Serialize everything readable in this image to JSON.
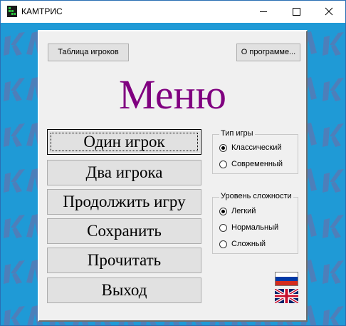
{
  "window": {
    "title": "КАМТРИС"
  },
  "toolbar": {
    "players_table": "Таблица игроков",
    "about": "О программе..."
  },
  "menu_title": "Меню",
  "main_buttons": {
    "one_player": "Один игрок",
    "two_players": "Два игрока",
    "continue_game": "Продолжить игру",
    "save": "Сохранить",
    "load": "Прочитать",
    "exit": "Выход"
  },
  "game_type": {
    "legend": "Тип игры",
    "options": [
      "Классический",
      "Современный"
    ],
    "selected": "Классический"
  },
  "difficulty": {
    "legend": "Уровень сложности",
    "options": [
      "Легкий",
      "Нормальный",
      "Сложный"
    ],
    "selected": "Легкий"
  },
  "languages": [
    "ru",
    "en"
  ],
  "colors": {
    "background": "#1f9ad6",
    "panel": "#f0f0f0",
    "title_purple": "#800080",
    "pattern": "#4d7fba"
  }
}
